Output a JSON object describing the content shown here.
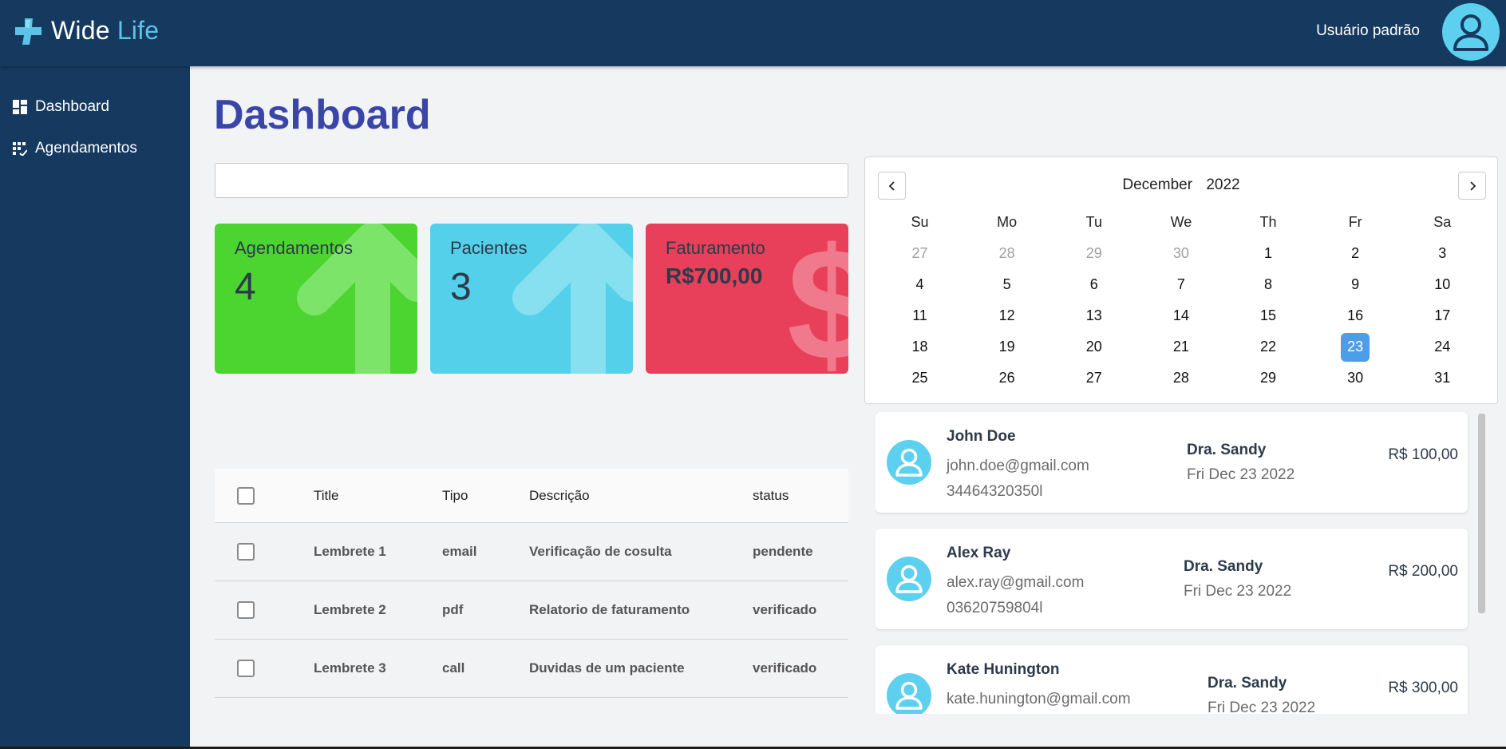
{
  "header": {
    "brand_primary": "Wide",
    "brand_accent": "Life",
    "user_name": "Usuário padrão",
    "logo_icon": "medical-cross-icon",
    "avatar_icon": "user-avatar-icon"
  },
  "sidebar": {
    "items": [
      {
        "label": "Dashboard",
        "icon": "dashboard-icon"
      },
      {
        "label": "Agendamentos",
        "icon": "calendar-grid-icon"
      }
    ]
  },
  "main": {
    "title": "Dashboard",
    "search": {
      "value": "",
      "placeholder": ""
    }
  },
  "cards": [
    {
      "label": "Agendamentos",
      "value": "4",
      "color": "#4cd530",
      "icon": "arrow-up-icon"
    },
    {
      "label": "Pacientes",
      "value": "3",
      "color": "#54d0ea",
      "icon": "arrow-up-icon"
    },
    {
      "label": "Faturamento",
      "value": "R$700,00",
      "color": "#e8405a",
      "icon": "dollar-sign-icon"
    }
  ],
  "table": {
    "headers": {
      "title": "Title",
      "tipo": "Tipo",
      "descricao": "Descrição",
      "status": "status"
    },
    "rows": [
      {
        "title": "Lembrete 1",
        "tipo": "email",
        "descricao": "Verificação de cosulta",
        "status": "pendente"
      },
      {
        "title": "Lembrete 2",
        "tipo": "pdf",
        "descricao": "Relatorio de faturamento",
        "status": "verificado"
      },
      {
        "title": "Lembrete 3",
        "tipo": "call",
        "descricao": "Duvidas de um paciente",
        "status": "verificado"
      }
    ]
  },
  "calendar": {
    "month": "December",
    "year": "2022",
    "weekdays": [
      "Su",
      "Mo",
      "Tu",
      "We",
      "Th",
      "Fr",
      "Sa"
    ],
    "weeks": [
      [
        "27",
        "28",
        "29",
        "30",
        "1",
        "2",
        "3"
      ],
      [
        "4",
        "5",
        "6",
        "7",
        "8",
        "9",
        "10"
      ],
      [
        "11",
        "12",
        "13",
        "14",
        "15",
        "16",
        "17"
      ],
      [
        "18",
        "19",
        "20",
        "21",
        "22",
        "23",
        "24"
      ],
      [
        "25",
        "26",
        "27",
        "28",
        "29",
        "30",
        "31"
      ]
    ],
    "selected_day": "23"
  },
  "appointments": [
    {
      "name": "John Doe",
      "email": "john.doe@gmail.com",
      "phone": "34464320350l",
      "doctor": "Dra. Sandy",
      "date": "Fri Dec 23 2022",
      "price": "R$ 100,00"
    },
    {
      "name": "Alex Ray",
      "email": "alex.ray@gmail.com",
      "phone": "03620759804l",
      "doctor": "Dra. Sandy",
      "date": "Fri Dec 23 2022",
      "price": "R$ 200,00"
    },
    {
      "name": "Kate Hunington",
      "email": "kate.hunington@gmail.com",
      "phone": "",
      "doctor": "Dra. Sandy",
      "date": "Fri Dec 23 2022",
      "price": "R$ 300,00"
    }
  ]
}
